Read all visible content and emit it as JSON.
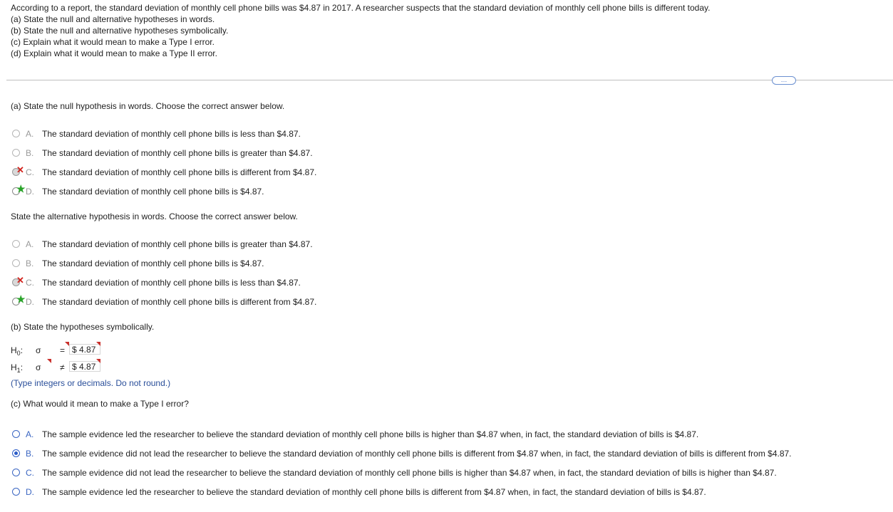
{
  "question": {
    "intro": "According to a report, the standard deviation of monthly cell phone bills was $4.87 in 2017. A researcher suspects that the standard deviation of monthly cell phone bills is different today.",
    "parts": [
      "(a) State the null and alternative hypotheses in words.",
      "(b) State the null and alternative hypotheses symbolically.",
      "(c) Explain what it would mean to make a Type I error.",
      "(d) Explain what it would mean to make a Type II error."
    ]
  },
  "more_button": "…",
  "part_a": {
    "prompt": "(a) State the null hypothesis in words. Choose the correct answer below.",
    "options": [
      {
        "letter": "A.",
        "text": "The standard deviation of monthly cell phone bills is less than $4.87.",
        "state": "none"
      },
      {
        "letter": "B.",
        "text": "The standard deviation of monthly cell phone bills is greater than $4.87.",
        "state": "none"
      },
      {
        "letter": "C.",
        "text": "The standard deviation of monthly cell phone bills is different from $4.87.",
        "state": "incorrect"
      },
      {
        "letter": "D.",
        "text": "The standard deviation of monthly cell phone bills is $4.87.",
        "state": "correct"
      }
    ],
    "alt_prompt": "State the alternative hypothesis in words. Choose the correct answer below.",
    "alt_options": [
      {
        "letter": "A.",
        "text": "The standard deviation of monthly cell phone bills is greater than $4.87.",
        "state": "none"
      },
      {
        "letter": "B.",
        "text": "The standard deviation of monthly cell phone bills is $4.87.",
        "state": "none"
      },
      {
        "letter": "C.",
        "text": "The standard deviation of monthly cell phone bills is less than $4.87.",
        "state": "incorrect"
      },
      {
        "letter": "D.",
        "text": "The standard deviation of monthly cell phone bills is different from $4.87.",
        "state": "correct"
      }
    ]
  },
  "part_b": {
    "prompt": "(b) State the hypotheses symbolically.",
    "h0": {
      "label": "H",
      "sub": "0",
      "param": "σ",
      "op": "=",
      "value": "$ 4.87"
    },
    "h1": {
      "label": "H",
      "sub": "1",
      "param": "σ",
      "op": "≠",
      "value": "$ 4.87"
    },
    "hint": "(Type integers or decimals. Do not round.)"
  },
  "part_c": {
    "prompt": "(c) What would it mean to make a Type I error?",
    "options": [
      {
        "letter": "A.",
        "text": "The sample evidence led the researcher to believe the standard deviation of monthly cell phone bills is higher than $4.87 when, in fact, the standard deviation of bills is $4.87."
      },
      {
        "letter": "B.",
        "text": "The sample evidence did not lead the researcher to believe the standard deviation of monthly cell phone bills is different from $4.87 when, in fact, the standard deviation of bills is different from $4.87."
      },
      {
        "letter": "C.",
        "text": "The sample evidence did not lead the researcher to believe the standard deviation of monthly cell phone bills is higher than $4.87 when, in fact, the standard deviation of bills is higher than $4.87."
      },
      {
        "letter": "D.",
        "text": "The sample evidence led the researcher to believe the standard deviation of monthly cell phone bills is different from $4.87 when, in fact, the standard deviation of bills is $4.87."
      }
    ],
    "selected": "B."
  },
  "colors": {
    "accent": "#2b5cc7",
    "incorrect": "#d2201a",
    "correct": "#29a329"
  }
}
